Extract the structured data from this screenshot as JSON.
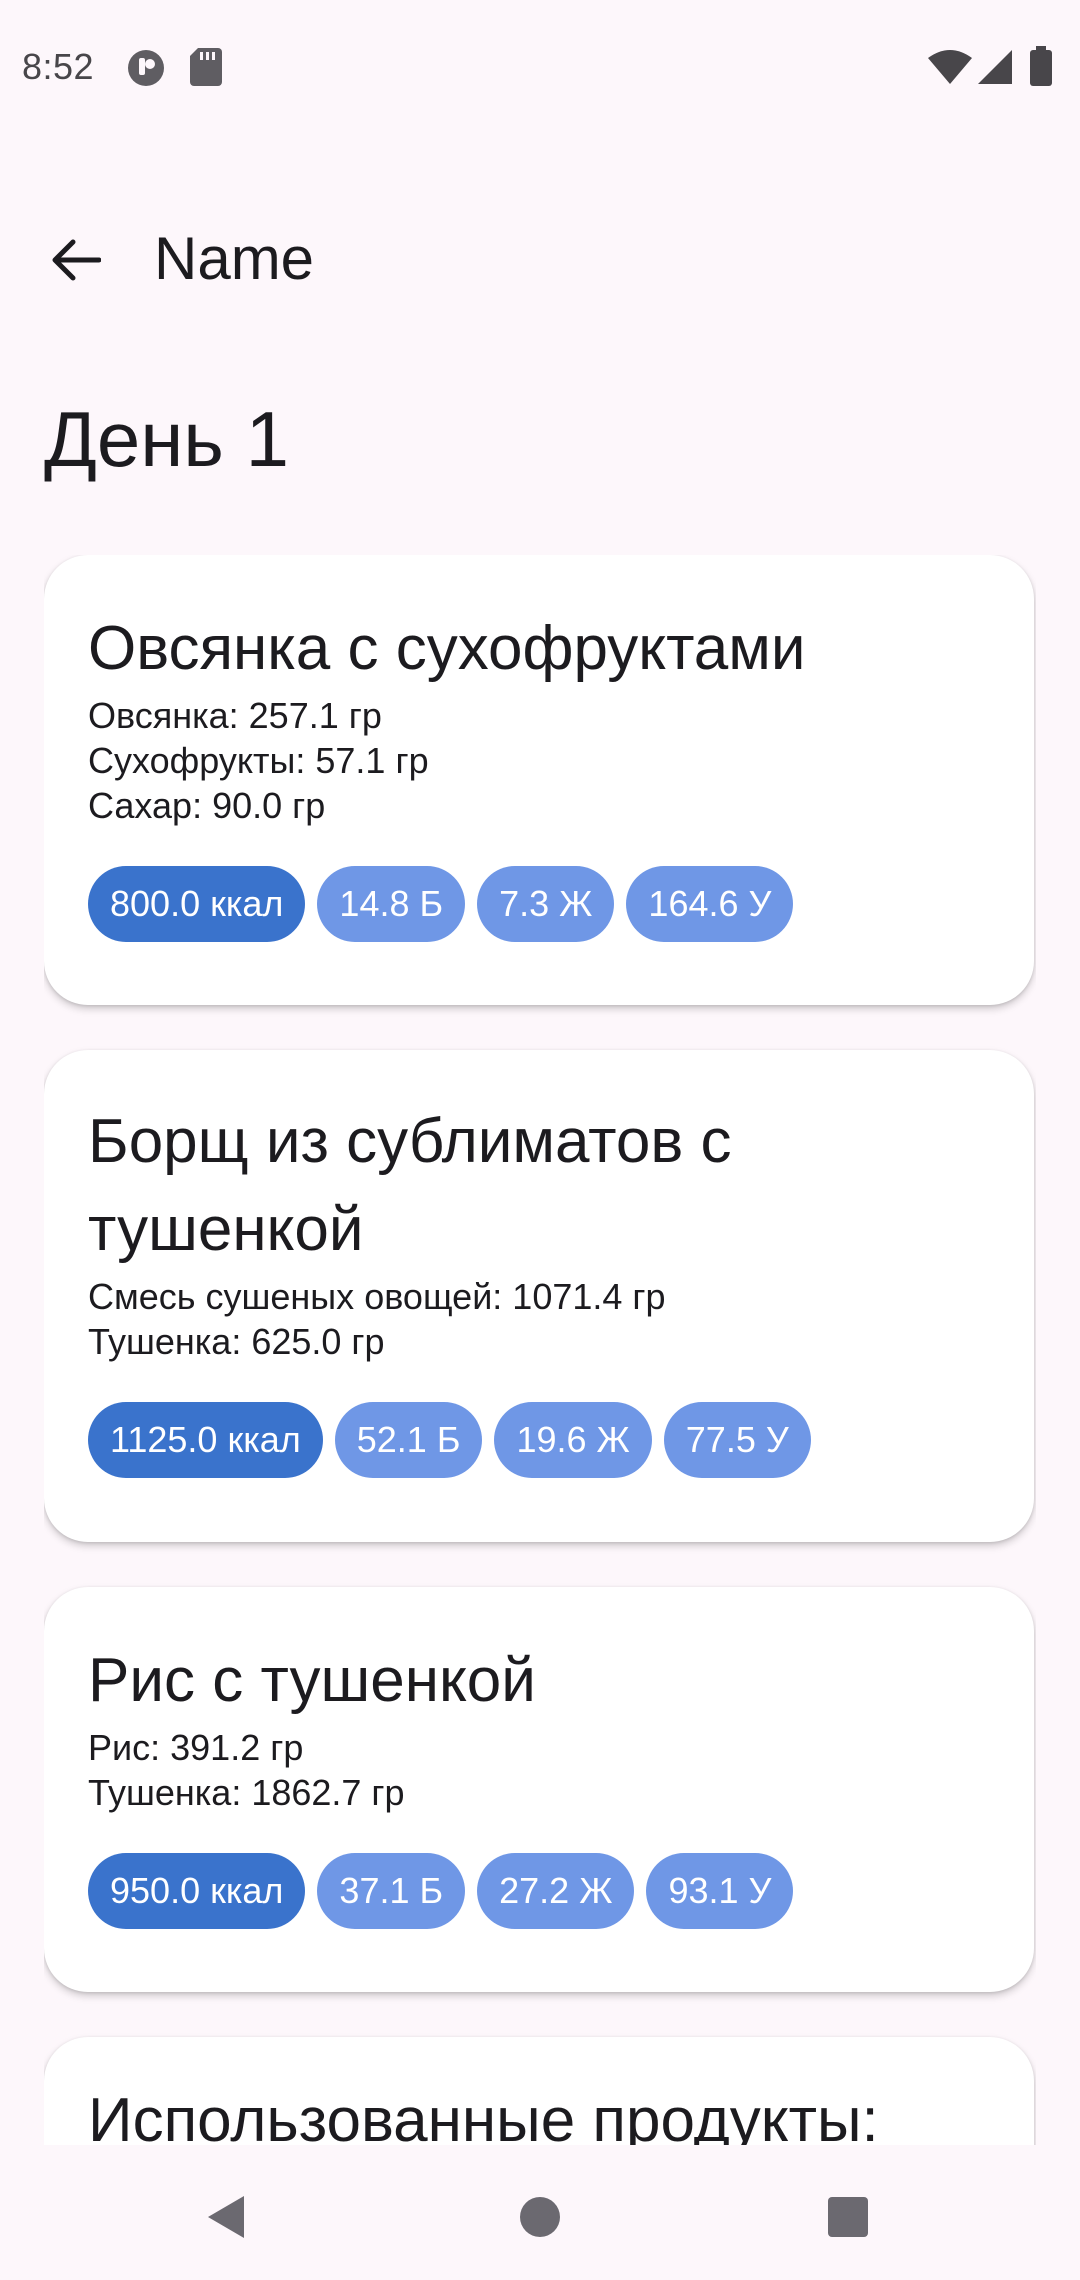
{
  "status_bar": {
    "time": "8:52",
    "icons": [
      "app-notification-icon",
      "sd-card-icon",
      "wifi-icon",
      "signal-icon",
      "battery-icon"
    ]
  },
  "app_bar": {
    "title": "Name",
    "back_icon": "arrow-back-icon"
  },
  "day_title": "День 1",
  "meals": [
    {
      "title": "Овсянка с сухофруктами",
      "ingredients": [
        "Овсянка: 257.1 гр",
        "Сухофрукты: 57.1 гр",
        "Сахар: 90.0 гр"
      ],
      "kcal": "800.0 ккал",
      "protein": "14.8 Б",
      "fat": "7.3 Ж",
      "carbs": "164.6 У"
    },
    {
      "title": "Борщ из сублиматов с тушенкой",
      "ingredients": [
        "Смесь сушеных овощей: 1071.4 гр",
        "Тушенка: 625.0 гр"
      ],
      "kcal": "1125.0 ккал",
      "protein": "52.1 Б",
      "fat": "19.6 Ж",
      "carbs": "77.5 У"
    },
    {
      "title": "Рис с тушенкой",
      "ingredients": [
        "Рис: 391.2 гр",
        "Тушенка: 1862.7 гр"
      ],
      "kcal": "950.0 ккал",
      "protein": "37.1 Б",
      "fat": "27.2 Ж",
      "carbs": "93.1 У"
    }
  ],
  "used_products": {
    "title": "Использованные продукты:"
  },
  "nav_bar": {
    "icons": [
      "back-triangle-icon",
      "home-circle-icon",
      "recents-square-icon"
    ]
  },
  "colors": {
    "background": "#fdf7fb",
    "card": "#ffffff",
    "chip_kcal": "#3a73cc",
    "chip_macro": "#6f97e6",
    "text": "#1c1b1f"
  }
}
